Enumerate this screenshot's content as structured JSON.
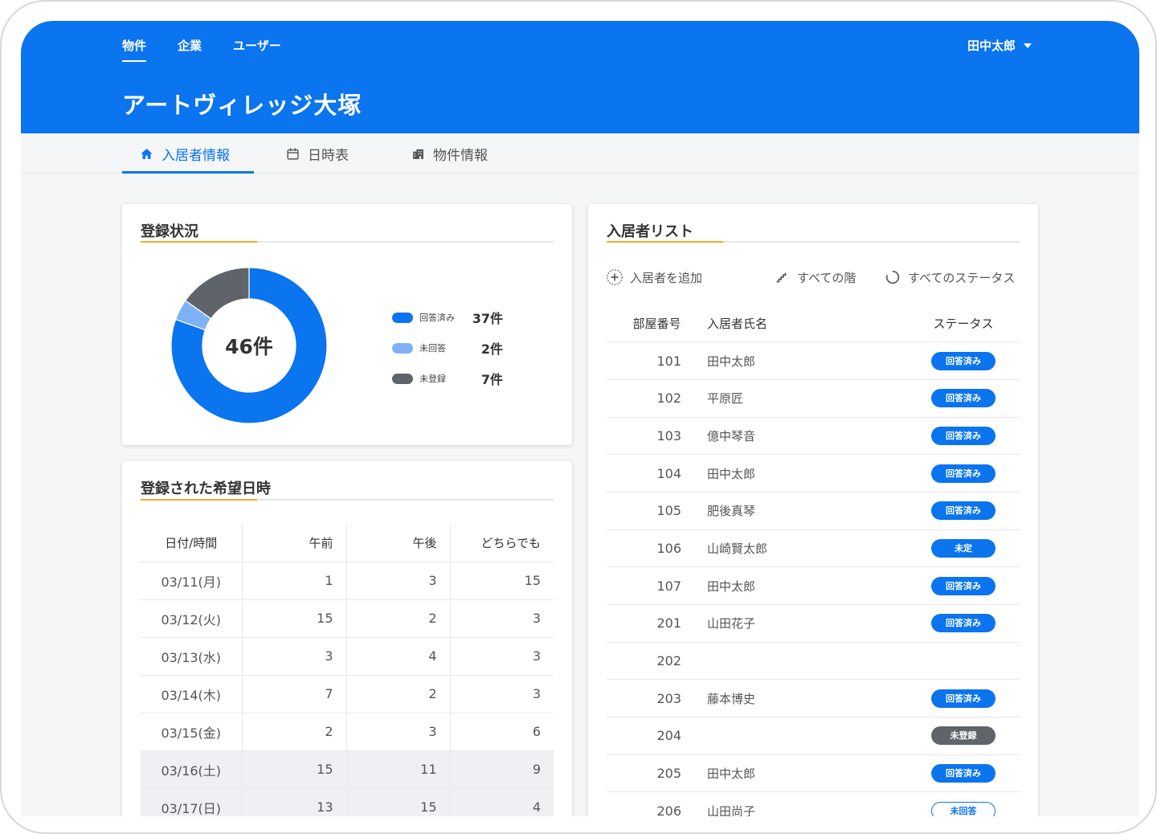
{
  "header": {
    "nav": [
      "物件",
      "企業",
      "ユーザー"
    ],
    "user_name": "田中太郎",
    "title": "アートヴィレッジ大塚"
  },
  "tabs": [
    {
      "label": "入居者情報",
      "icon": "home-icon"
    },
    {
      "label": "日時表",
      "icon": "calendar-icon"
    },
    {
      "label": "物件情報",
      "icon": "building-icon"
    }
  ],
  "registration": {
    "title": "登録状況",
    "total_label": "46件",
    "legend": [
      {
        "label": "回答済み",
        "value_label": "37件",
        "count": 37,
        "color": "#0b74ef"
      },
      {
        "label": "未回答",
        "value_label": "2件",
        "count": 2,
        "color": "#7eb2f5"
      },
      {
        "label": "未登録",
        "value_label": "7件",
        "count": 7,
        "color": "#5f646a"
      }
    ]
  },
  "schedule": {
    "title": "登録された希望日時",
    "headers": [
      "日付/時間",
      "午前",
      "午後",
      "どちらでも"
    ],
    "rows": [
      [
        "03/11(月)",
        "1",
        "3",
        "15"
      ],
      [
        "03/12(火)",
        "15",
        "2",
        "3"
      ],
      [
        "03/13(水)",
        "3",
        "4",
        "3"
      ],
      [
        "03/14(木)",
        "7",
        "2",
        "3"
      ],
      [
        "03/15(金)",
        "2",
        "3",
        "6"
      ],
      [
        "03/16(土)",
        "15",
        "11",
        "9"
      ],
      [
        "03/17(日)",
        "13",
        "15",
        "4"
      ]
    ]
  },
  "residents": {
    "title": "入居者リスト",
    "add_label": "入居者を追加",
    "floor_filter": "すべての階",
    "status_filter": "すべてのステータス",
    "headers": [
      "部屋番号",
      "入居者氏名",
      "ステータス"
    ],
    "rows": [
      {
        "room": "101",
        "name": "田中太郎",
        "status": "回答済み",
        "kind": "answered"
      },
      {
        "room": "102",
        "name": "平原匠",
        "status": "回答済み",
        "kind": "answered"
      },
      {
        "room": "103",
        "name": "億中琴音",
        "status": "回答済み",
        "kind": "answered"
      },
      {
        "room": "104",
        "name": "田中太郎",
        "status": "回答済み",
        "kind": "answered"
      },
      {
        "room": "105",
        "name": "肥後真琴",
        "status": "回答済み",
        "kind": "answered"
      },
      {
        "room": "106",
        "name": "山崎賢太郎",
        "status": "未定",
        "kind": "undecided"
      },
      {
        "room": "107",
        "name": "田中太郎",
        "status": "回答済み",
        "kind": "answered"
      },
      {
        "room": "201",
        "name": "山田花子",
        "status": "回答済み",
        "kind": "answered"
      },
      {
        "room": "202",
        "name": "",
        "status": "",
        "kind": ""
      },
      {
        "room": "203",
        "name": "藤本博史",
        "status": "回答済み",
        "kind": "answered"
      },
      {
        "room": "204",
        "name": "",
        "status": "未登録",
        "kind": "unregistered"
      },
      {
        "room": "205",
        "name": "田中太郎",
        "status": "回答済み",
        "kind": "answered"
      },
      {
        "room": "206",
        "name": "山田尚子",
        "status": "未回答",
        "kind": "unanswered"
      }
    ]
  }
}
